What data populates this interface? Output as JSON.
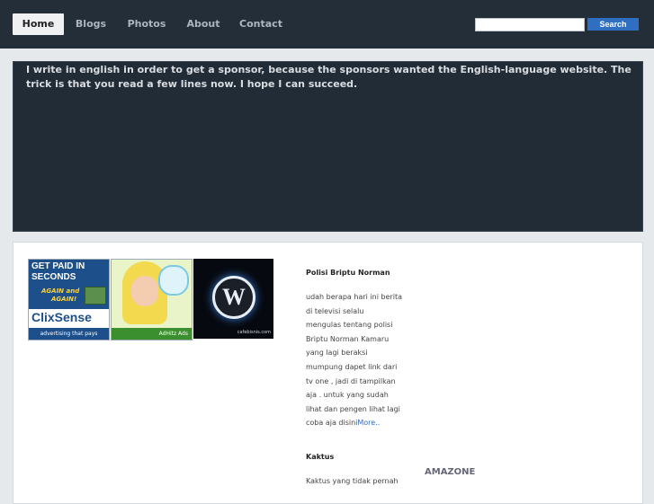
{
  "nav": {
    "items": [
      {
        "label": "Home",
        "active": true
      },
      {
        "label": "Blogs",
        "active": false
      },
      {
        "label": "Photos",
        "active": false
      },
      {
        "label": "About",
        "active": false
      },
      {
        "label": "Contact",
        "active": false
      }
    ]
  },
  "search": {
    "placeholder": "",
    "button_label": "Search"
  },
  "intro": {
    "text": "I write in english in order to get a sponsor, because the sponsors wanted the English-language website. The trick is that you read a few lines now. I hope I can succeed."
  },
  "ads": {
    "clixsense": {
      "line1": "GET PAID IN",
      "line2": "SECONDS",
      "again1": "AGAIN and",
      "again2": "AGAIN!",
      "logo": "ClixSense",
      "tagline": "advertising that pays"
    },
    "adhitz": {
      "tagline": "AdHitz Ads"
    },
    "wordpress": {
      "logo_letter": "W",
      "tagline": "cafebisnis.com"
    }
  },
  "posts": [
    {
      "title": "Polisi Briptu Norman",
      "body_lines": [
        "udah berapa hari ini berita",
        "di televisi selalu",
        "mengulas tentang polisi",
        "Briptu Norman Kamaru",
        "yang lagi beraksi",
        "mumpung dapet link dari",
        "tv one , jadi di tampilkan",
        "aja . untuk yang sudah",
        "lihat dan pengen lihat lagi",
        "coba aja disini"
      ],
      "more_label": "More.."
    },
    {
      "title": "Kaktus",
      "body_lines": [
        "Kaktus yang tidak pernah"
      ]
    }
  ],
  "sidebar": {
    "heading": "AMAZONE"
  },
  "colors": {
    "topbar": "#242e38",
    "accent": "#2f6fc1",
    "intro_bg": "#222c36",
    "page_bg": "#e6e9ec"
  }
}
